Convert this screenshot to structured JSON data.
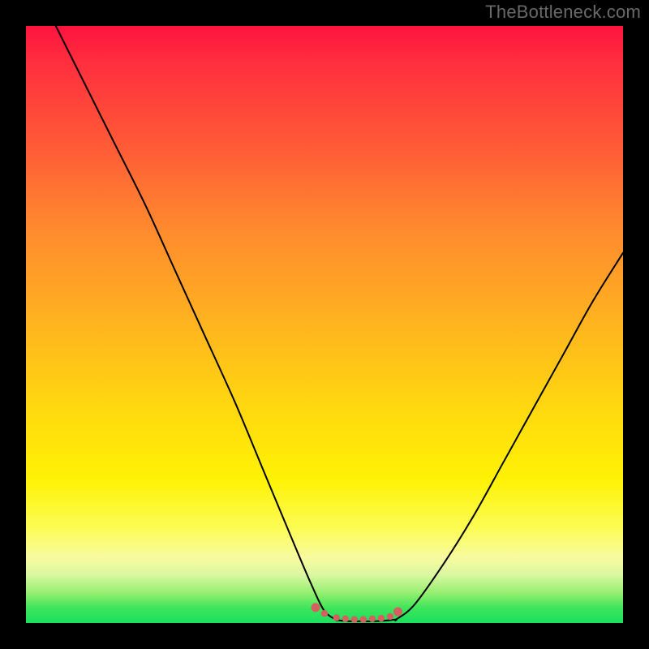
{
  "watermark": "TheBottleneck.com",
  "chart_data": {
    "type": "line",
    "title": "",
    "xlabel": "",
    "ylabel": "",
    "xlim": [
      0,
      100
    ],
    "ylim": [
      0,
      100
    ],
    "series": [
      {
        "name": "bottleneck-curve-left",
        "x": [
          5,
          10,
          15,
          20,
          25,
          30,
          35,
          40,
          45,
          48,
          50,
          52
        ],
        "values": [
          100,
          90,
          80,
          70,
          59,
          48,
          37,
          25,
          13,
          6,
          2,
          0.5
        ]
      },
      {
        "name": "bottleneck-valley",
        "x": [
          52,
          54,
          56,
          58,
          60,
          62
        ],
        "values": [
          0.5,
          0.3,
          0.3,
          0.3,
          0.4,
          0.6
        ]
      },
      {
        "name": "bottleneck-curve-right",
        "x": [
          62,
          65,
          70,
          75,
          80,
          85,
          90,
          95,
          100
        ],
        "values": [
          0.6,
          3,
          10,
          18,
          27,
          36,
          45,
          54,
          62
        ]
      }
    ],
    "markers": {
      "name": "valley-dots",
      "color": "#d46060",
      "x": [
        48.5,
        50,
        52,
        53.5,
        55,
        56.5,
        58,
        59.5,
        61,
        62.3
      ],
      "values": [
        2.6,
        1.6,
        0.9,
        0.7,
        0.6,
        0.6,
        0.7,
        0.8,
        1.1,
        1.9
      ]
    },
    "gradient_stops": [
      {
        "pct": 0,
        "color": "#ff133f"
      },
      {
        "pct": 20,
        "color": "#ff5a37"
      },
      {
        "pct": 50,
        "color": "#ffb41f"
      },
      {
        "pct": 76,
        "color": "#fff205"
      },
      {
        "pct": 92,
        "color": "#d9f7a0"
      },
      {
        "pct": 100,
        "color": "#19df5e"
      }
    ]
  }
}
